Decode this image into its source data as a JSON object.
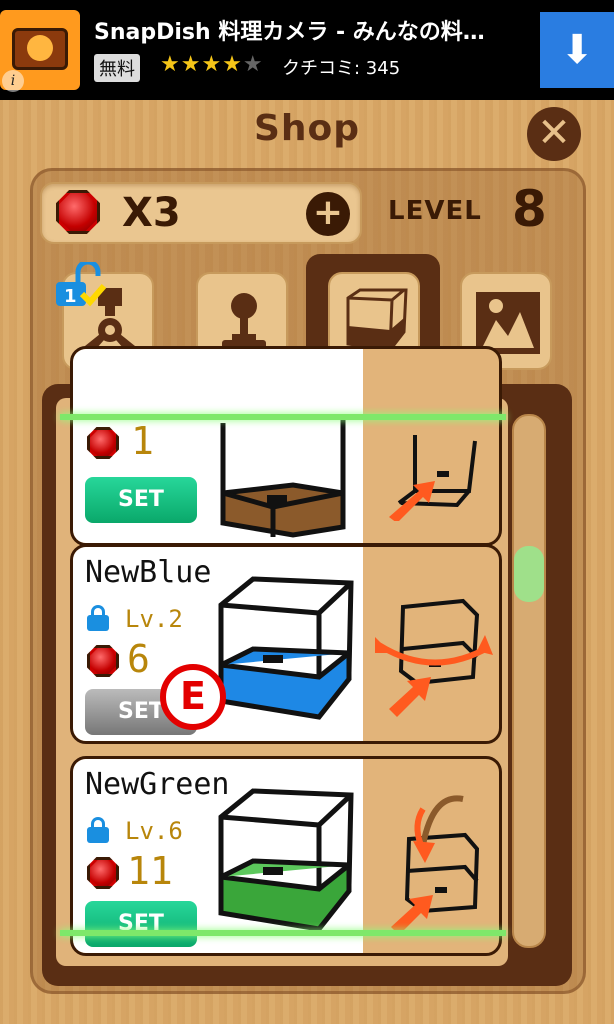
{
  "ad": {
    "title": "SnapDish 料理カメラ - みんなの料…",
    "free_label": "無料",
    "stars_filled": "★★★★",
    "stars_empty": "★",
    "reviews": "クチコミ: 345",
    "info": "i",
    "download_icon": "⬇"
  },
  "header": {
    "title": "Shop",
    "close_label": "✕"
  },
  "gems": {
    "count": "X3",
    "plus": "+"
  },
  "level": {
    "label": "LEVEL",
    "value": "8"
  },
  "tabs": [
    {
      "name": "claw",
      "icon": "claw-icon",
      "locked_badge": true
    },
    {
      "name": "joystick",
      "icon": "joystick-icon"
    },
    {
      "name": "cabinet",
      "icon": "cabinet-icon",
      "active": true
    },
    {
      "name": "background",
      "icon": "picture-icon"
    }
  ],
  "items": [
    {
      "name": "",
      "level": "",
      "price": "1",
      "set_label": "SET",
      "box_color": "#8b5a2b"
    },
    {
      "name": "NewBlue",
      "level": "Lv.2",
      "price": "6",
      "set_label": "SET",
      "box_color": "#1e88e5"
    },
    {
      "name": "NewGreen",
      "level": "Lv.6",
      "price": "11",
      "set_label": "SET",
      "box_color": "#3aa63a"
    }
  ],
  "badge": {
    "text": "E"
  }
}
